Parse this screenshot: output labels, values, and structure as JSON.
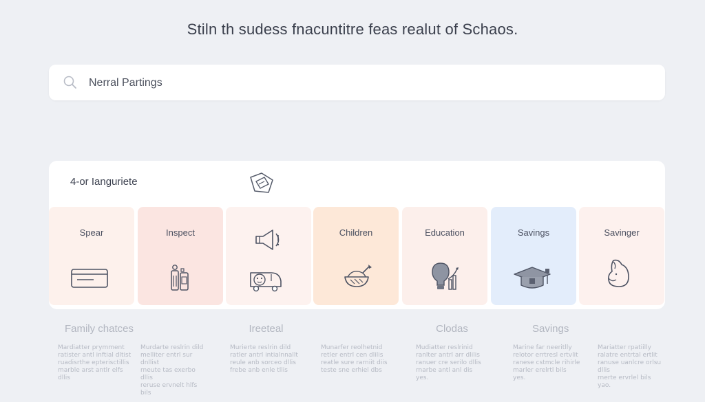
{
  "headline": "Stiln th sudess fnacuntitre feas realut of Schaos.",
  "search": {
    "value": "Nerral Partings"
  },
  "panel": {
    "title": "4-or Ianguriete",
    "cards": [
      {
        "label": "Spear",
        "icon": "tray-icon",
        "bg": "#fdf1ec"
      },
      {
        "label": "Inspect",
        "icon": "bottles-icon",
        "bg": "#fbe5e1"
      },
      {
        "label": "",
        "icon": "megaphone-icon",
        "bg": "#fdf2ef"
      },
      {
        "label": "Children",
        "icon": "bowl-icon",
        "bg": "#fde8d8"
      },
      {
        "label": "Education",
        "icon": "lightbulb-icon",
        "bg": "#fcefeb"
      },
      {
        "label": "Savings",
        "icon": "graduation-cap-icon",
        "bg": "#e3edfb"
      },
      {
        "label": "Savinger",
        "icon": "piggy-bank-icon",
        "bg": "#fdf1ee"
      }
    ]
  },
  "footer": [
    {
      "heading": "Family chatces",
      "lines": [
        "Mardiatter prymment",
        "ratister antl inftial dltist",
        "ruadisrthe epterisctillis",
        "marble arst antlr elfs dllis"
      ]
    },
    {
      "heading": "",
      "lines": [
        "Murdarte reslrin dild",
        "melliter entrl sur dnllist",
        "rneute tas exerbo dllis",
        "reruse ervnelt hlfs bils"
      ]
    },
    {
      "heading": "Ireeteal",
      "lines": [
        "Murierte reslrin dild",
        "ratler antrl intialnnallt",
        "reule anb sorceo dllis",
        "frebe anb enle tllis"
      ]
    },
    {
      "heading": "",
      "lines": [
        "Munarfer reolhetnid",
        "retler entrl cen dlilis",
        "reatle sure rarniit diis",
        "teste sne erhiel dbs"
      ]
    },
    {
      "heading": "Clodas",
      "lines": [
        "Mudiatter reslrinid",
        "ranlter antrl arr dlilis",
        "ranuer cre serilo dllis",
        "rnarbe antl anl dis",
        "yes."
      ]
    },
    {
      "heading": "Savings",
      "lines": [
        "Marine far neeritlly",
        "relotor errtresl ertvlit",
        "ranese cstmcle rihirle",
        "marler erelrtl bils",
        "yes."
      ]
    },
    {
      "heading": "",
      "lines": [
        "Mariatter rpatiilly",
        "ralatre entrtal ertlit",
        "ranuse uanlcre orlsu dllis",
        "rnerte ervrlel bils",
        "yao."
      ]
    }
  ]
}
